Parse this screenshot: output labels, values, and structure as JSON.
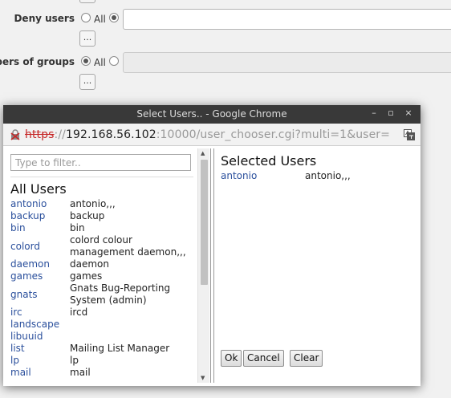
{
  "form": {
    "deny_users": {
      "label": "Deny users",
      "all_label": "All"
    },
    "members_of_groups": {
      "label": "bers of groups",
      "all_label": "All"
    },
    "choose_button_label": "..."
  },
  "popup": {
    "title": "Select Users.. - Google Chrome",
    "controls": {
      "minimize": "–",
      "maximize": "▫",
      "close": "×"
    },
    "address": {
      "scheme": "https",
      "separator": "://",
      "host": "192.168.56.102",
      "path": ":10000/user_chooser.cgi?multi=1&user="
    },
    "filter_placeholder": "Type to filter..",
    "all_users_heading": "All Users",
    "users": [
      {
        "name": "antonio",
        "real": "antonio,,,"
      },
      {
        "name": "backup",
        "real": "backup"
      },
      {
        "name": "bin",
        "real": "bin"
      },
      {
        "name": "colord",
        "real": "colord colour management daemon,,,"
      },
      {
        "name": "daemon",
        "real": "daemon"
      },
      {
        "name": "games",
        "real": "games"
      },
      {
        "name": "gnats",
        "real": "Gnats Bug-Reporting System (admin)"
      },
      {
        "name": "irc",
        "real": "ircd"
      },
      {
        "name": "landscape",
        "real": ""
      },
      {
        "name": "libuuid",
        "real": ""
      },
      {
        "name": "list",
        "real": "Mailing List Manager"
      },
      {
        "name": "lp",
        "real": "lp"
      },
      {
        "name": "mail",
        "real": "mail"
      }
    ],
    "selected_heading": "Selected Users",
    "selected_users": [
      {
        "name": "antonio",
        "real": "antonio,,,"
      }
    ],
    "buttons": {
      "ok": "Ok",
      "cancel": "Cancel",
      "clear": "Clear"
    }
  }
}
